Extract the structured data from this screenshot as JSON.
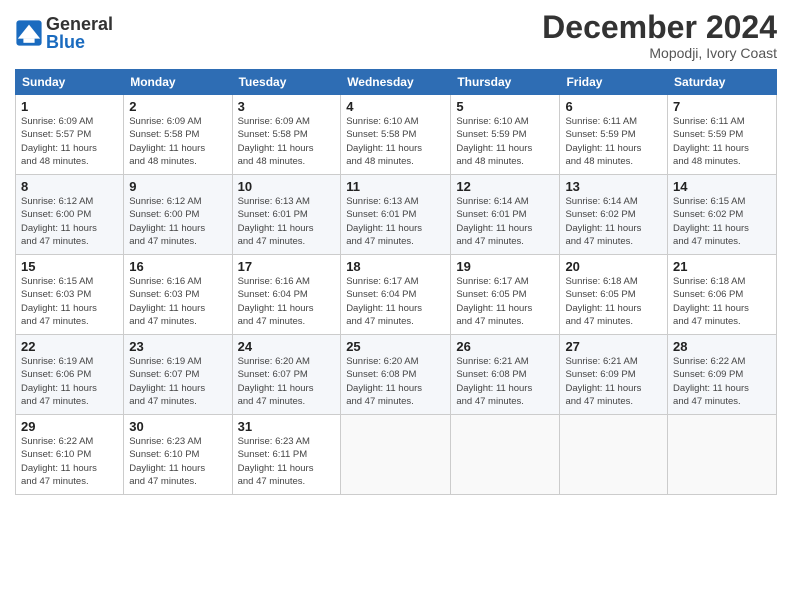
{
  "logo": {
    "text_general": "General",
    "text_blue": "Blue"
  },
  "header": {
    "title": "December 2024",
    "subtitle": "Mopodji, Ivory Coast"
  },
  "days_of_week": [
    "Sunday",
    "Monday",
    "Tuesday",
    "Wednesday",
    "Thursday",
    "Friday",
    "Saturday"
  ],
  "weeks": [
    [
      {
        "day": "1",
        "detail": "Sunrise: 6:09 AM\nSunset: 5:57 PM\nDaylight: 11 hours\nand 48 minutes."
      },
      {
        "day": "2",
        "detail": "Sunrise: 6:09 AM\nSunset: 5:58 PM\nDaylight: 11 hours\nand 48 minutes."
      },
      {
        "day": "3",
        "detail": "Sunrise: 6:09 AM\nSunset: 5:58 PM\nDaylight: 11 hours\nand 48 minutes."
      },
      {
        "day": "4",
        "detail": "Sunrise: 6:10 AM\nSunset: 5:58 PM\nDaylight: 11 hours\nand 48 minutes."
      },
      {
        "day": "5",
        "detail": "Sunrise: 6:10 AM\nSunset: 5:59 PM\nDaylight: 11 hours\nand 48 minutes."
      },
      {
        "day": "6",
        "detail": "Sunrise: 6:11 AM\nSunset: 5:59 PM\nDaylight: 11 hours\nand 48 minutes."
      },
      {
        "day": "7",
        "detail": "Sunrise: 6:11 AM\nSunset: 5:59 PM\nDaylight: 11 hours\nand 48 minutes."
      }
    ],
    [
      {
        "day": "8",
        "detail": "Sunrise: 6:12 AM\nSunset: 6:00 PM\nDaylight: 11 hours\nand 47 minutes."
      },
      {
        "day": "9",
        "detail": "Sunrise: 6:12 AM\nSunset: 6:00 PM\nDaylight: 11 hours\nand 47 minutes."
      },
      {
        "day": "10",
        "detail": "Sunrise: 6:13 AM\nSunset: 6:01 PM\nDaylight: 11 hours\nand 47 minutes."
      },
      {
        "day": "11",
        "detail": "Sunrise: 6:13 AM\nSunset: 6:01 PM\nDaylight: 11 hours\nand 47 minutes."
      },
      {
        "day": "12",
        "detail": "Sunrise: 6:14 AM\nSunset: 6:01 PM\nDaylight: 11 hours\nand 47 minutes."
      },
      {
        "day": "13",
        "detail": "Sunrise: 6:14 AM\nSunset: 6:02 PM\nDaylight: 11 hours\nand 47 minutes."
      },
      {
        "day": "14",
        "detail": "Sunrise: 6:15 AM\nSunset: 6:02 PM\nDaylight: 11 hours\nand 47 minutes."
      }
    ],
    [
      {
        "day": "15",
        "detail": "Sunrise: 6:15 AM\nSunset: 6:03 PM\nDaylight: 11 hours\nand 47 minutes."
      },
      {
        "day": "16",
        "detail": "Sunrise: 6:16 AM\nSunset: 6:03 PM\nDaylight: 11 hours\nand 47 minutes."
      },
      {
        "day": "17",
        "detail": "Sunrise: 6:16 AM\nSunset: 6:04 PM\nDaylight: 11 hours\nand 47 minutes."
      },
      {
        "day": "18",
        "detail": "Sunrise: 6:17 AM\nSunset: 6:04 PM\nDaylight: 11 hours\nand 47 minutes."
      },
      {
        "day": "19",
        "detail": "Sunrise: 6:17 AM\nSunset: 6:05 PM\nDaylight: 11 hours\nand 47 minutes."
      },
      {
        "day": "20",
        "detail": "Sunrise: 6:18 AM\nSunset: 6:05 PM\nDaylight: 11 hours\nand 47 minutes."
      },
      {
        "day": "21",
        "detail": "Sunrise: 6:18 AM\nSunset: 6:06 PM\nDaylight: 11 hours\nand 47 minutes."
      }
    ],
    [
      {
        "day": "22",
        "detail": "Sunrise: 6:19 AM\nSunset: 6:06 PM\nDaylight: 11 hours\nand 47 minutes."
      },
      {
        "day": "23",
        "detail": "Sunrise: 6:19 AM\nSunset: 6:07 PM\nDaylight: 11 hours\nand 47 minutes."
      },
      {
        "day": "24",
        "detail": "Sunrise: 6:20 AM\nSunset: 6:07 PM\nDaylight: 11 hours\nand 47 minutes."
      },
      {
        "day": "25",
        "detail": "Sunrise: 6:20 AM\nSunset: 6:08 PM\nDaylight: 11 hours\nand 47 minutes."
      },
      {
        "day": "26",
        "detail": "Sunrise: 6:21 AM\nSunset: 6:08 PM\nDaylight: 11 hours\nand 47 minutes."
      },
      {
        "day": "27",
        "detail": "Sunrise: 6:21 AM\nSunset: 6:09 PM\nDaylight: 11 hours\nand 47 minutes."
      },
      {
        "day": "28",
        "detail": "Sunrise: 6:22 AM\nSunset: 6:09 PM\nDaylight: 11 hours\nand 47 minutes."
      }
    ],
    [
      {
        "day": "29",
        "detail": "Sunrise: 6:22 AM\nSunset: 6:10 PM\nDaylight: 11 hours\nand 47 minutes."
      },
      {
        "day": "30",
        "detail": "Sunrise: 6:23 AM\nSunset: 6:10 PM\nDaylight: 11 hours\nand 47 minutes."
      },
      {
        "day": "31",
        "detail": "Sunrise: 6:23 AM\nSunset: 6:11 PM\nDaylight: 11 hours\nand 47 minutes."
      },
      null,
      null,
      null,
      null
    ]
  ]
}
